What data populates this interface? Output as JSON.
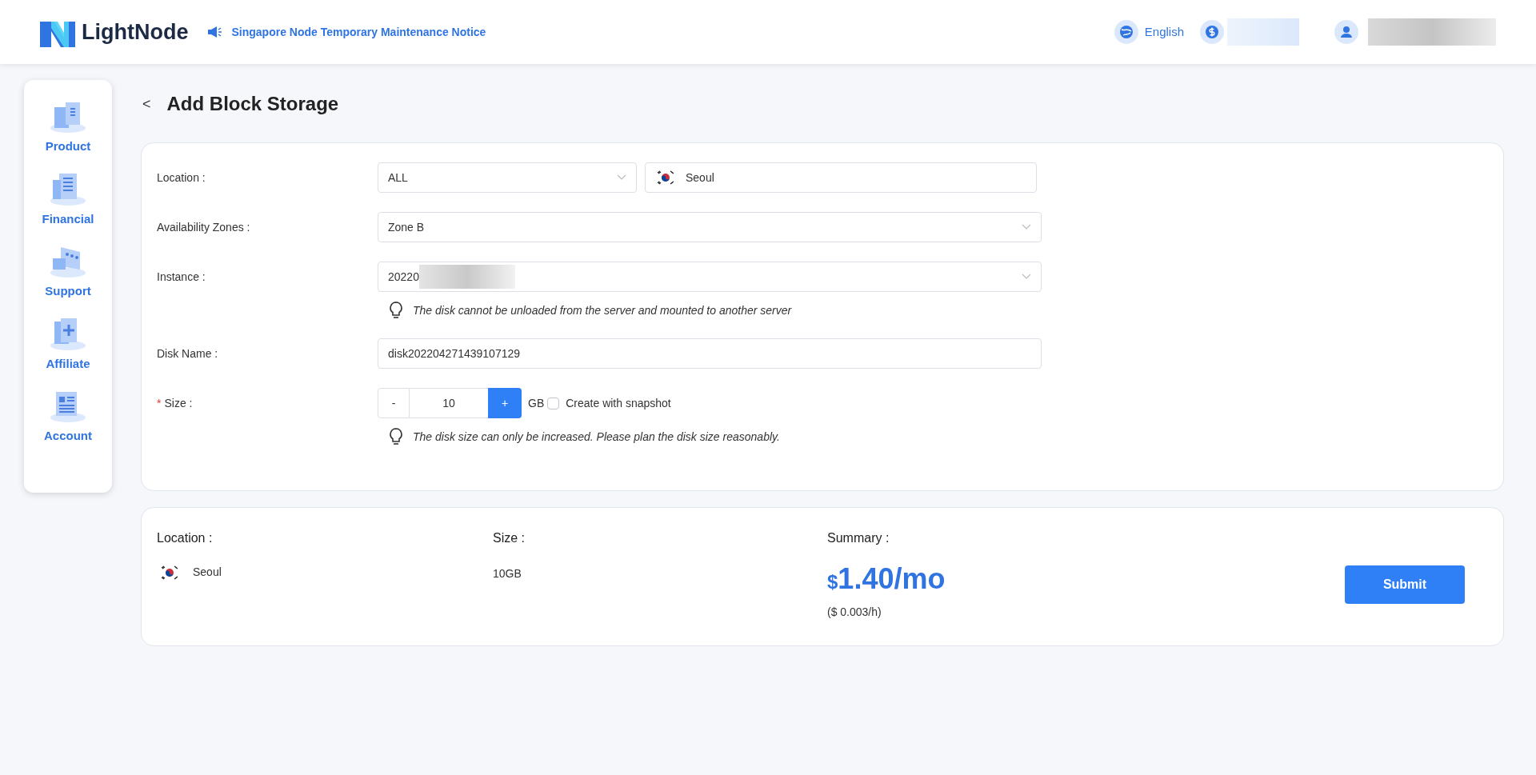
{
  "header": {
    "logo": "LightNode",
    "notice": "Singapore Node Temporary Maintenance Notice",
    "language": "English"
  },
  "sidebar": {
    "items": [
      {
        "label": "Product",
        "kind": "servers"
      },
      {
        "label": "Financial",
        "kind": "bill"
      },
      {
        "label": "Support",
        "kind": "chat"
      },
      {
        "label": "Affiliate",
        "kind": "plus"
      },
      {
        "label": "Account",
        "kind": "card"
      }
    ]
  },
  "page": {
    "back": "<",
    "title": "Add Block Storage"
  },
  "form": {
    "location": {
      "label": "Location :",
      "region": "ALL",
      "city": "Seoul"
    },
    "zone": {
      "label": "Availability Zones :",
      "value": "Zone B"
    },
    "instance": {
      "label": "Instance :",
      "value": "20220",
      "hint": "The disk cannot be unloaded from the server and mounted to another server"
    },
    "disk_name": {
      "label": "Disk Name :",
      "value": "disk202204271439107129"
    },
    "size": {
      "required_mark": "*",
      "label": "Size :",
      "minus": "-",
      "value": "10",
      "plus": "+",
      "unit": "GB",
      "snapshot": {
        "label": "Create with snapshot",
        "checked": false
      },
      "hint": "The disk size can only be increased. Please plan the disk size reasonably."
    }
  },
  "summary": {
    "location_label": "Location :",
    "location": "Seoul",
    "size_label": "Size :",
    "size": "10GB",
    "summary_label": "Summary :",
    "currency": "$",
    "price": "1.40/mo",
    "hourly": "($ 0.003/h)",
    "submit": "Submit"
  }
}
